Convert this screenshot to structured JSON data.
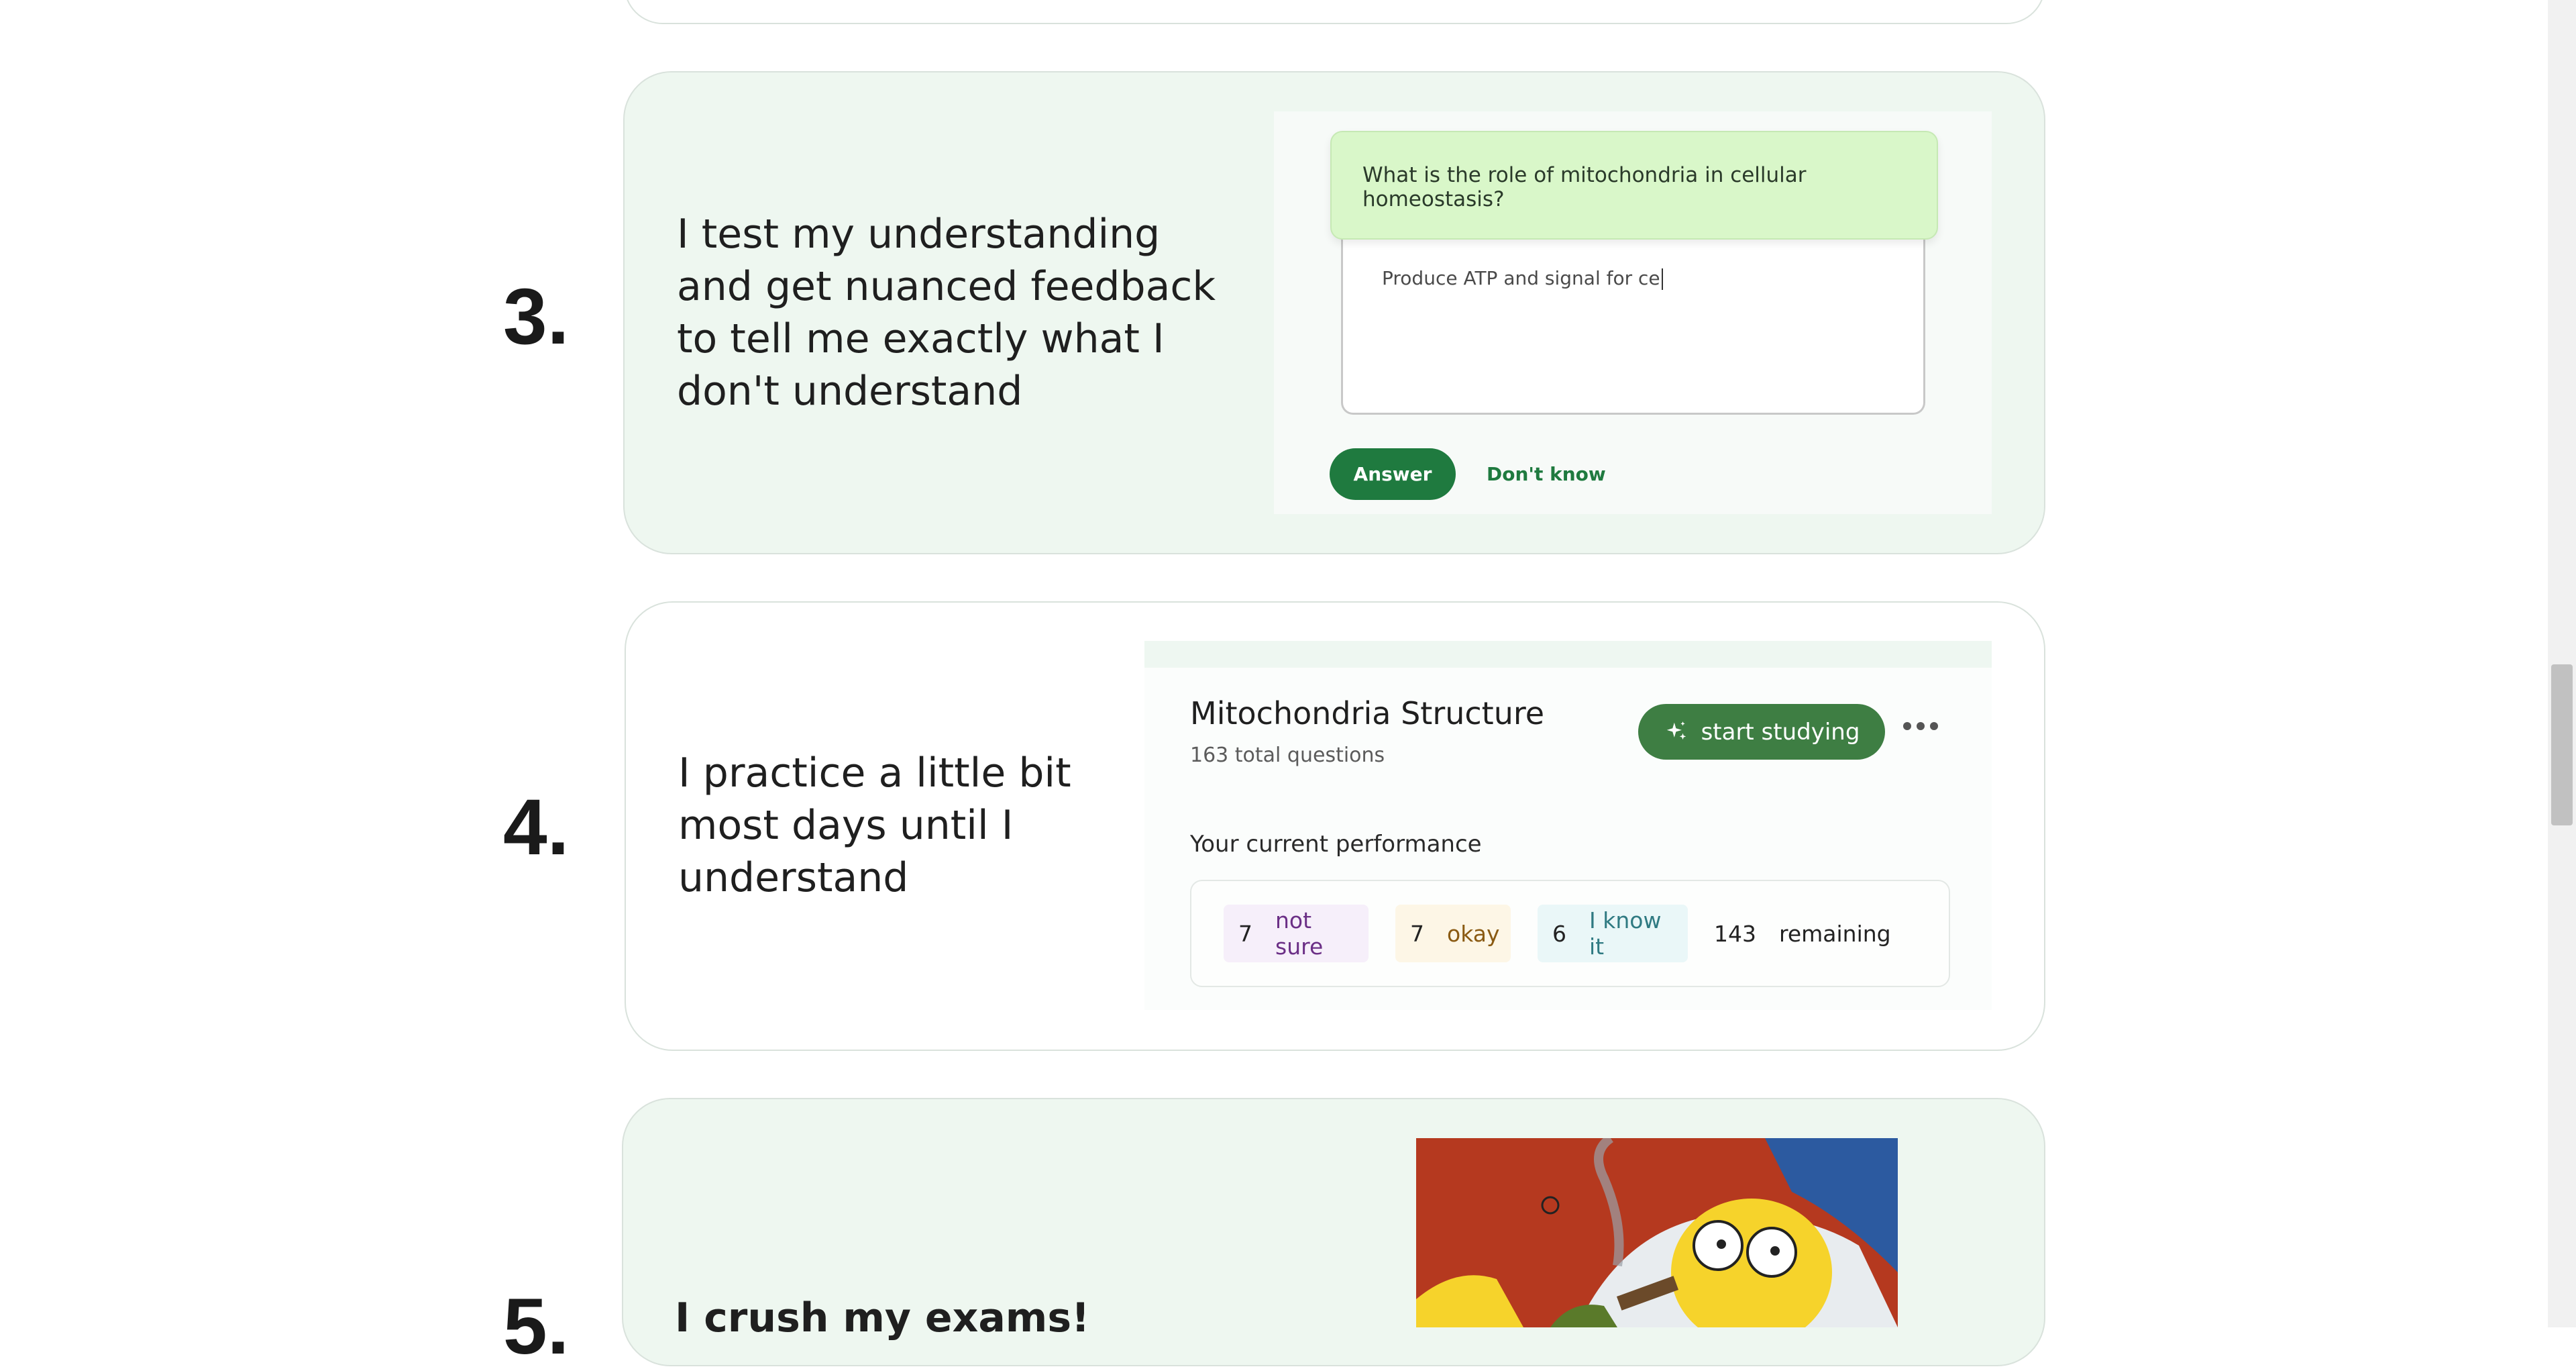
{
  "steps": [
    {
      "number": "3.",
      "headline": "I test my understanding and get nuanced feedback to tell me exactly what I don't understand"
    },
    {
      "number": "4.",
      "headline": "I practice a little bit most days until I understand"
    },
    {
      "number": "5.",
      "headline": "I crush my exams!"
    }
  ],
  "quiz": {
    "question": "What is the role of mitochondria in cellular homeostasis?",
    "answer_value": "Produce ATP and signal for ce",
    "answer_button": "Answer",
    "dont_know_button": "Don't know"
  },
  "deck": {
    "title": "Mitochondria Structure",
    "subtitle": "163 total questions",
    "start_button": "start studying",
    "performance_label": "Your current performance",
    "stats": [
      {
        "count": "7",
        "label": "not sure",
        "color": "#6b2f86",
        "bg": "#f6effa"
      },
      {
        "count": "7",
        "label": "okay",
        "color": "#8a5a12",
        "bg": "#fdf6e6"
      },
      {
        "count": "6",
        "label": "I know it",
        "color": "#2f7a82",
        "bg": "#eaf7f8"
      },
      {
        "count": "143",
        "label": "remaining",
        "color": "#222222",
        "bg": "#ffffff"
      }
    ]
  },
  "colors": {
    "accent_green": "#1f7a3f",
    "card_green_bg": "#eef7f0",
    "question_bg": "#d9f7c9",
    "study_button_bg": "#3e7e43"
  },
  "icons": {
    "sparkle": "sparkle-icon",
    "more": "more-options-icon"
  },
  "image5": {
    "description_visible": false
  }
}
